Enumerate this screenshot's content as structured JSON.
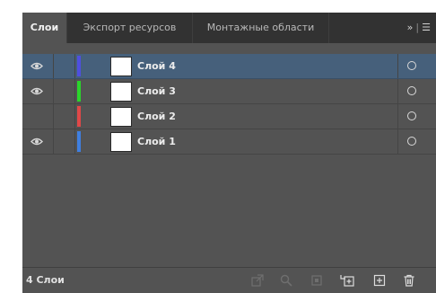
{
  "tabs": [
    {
      "label": "Слои",
      "active": true
    },
    {
      "label": "Экспорт ресурсов",
      "active": false
    },
    {
      "label": "Монтажные области",
      "active": false
    }
  ],
  "tab_menu": {
    "overflow": "»",
    "separator": "|",
    "menu": "☰"
  },
  "layers": [
    {
      "name": "Слой 4",
      "visible": true,
      "color": "#4f4fe0",
      "selected": true
    },
    {
      "name": "Слой 3",
      "visible": true,
      "color": "#2bd52b",
      "selected": false
    },
    {
      "name": "Слой 2",
      "visible": false,
      "color": "#e04848",
      "selected": false
    },
    {
      "name": "Слой 1",
      "visible": true,
      "color": "#3f7fe0",
      "selected": false
    }
  ],
  "footer": {
    "count_label": "4 Слои",
    "icons": [
      "export-icon",
      "search-icon",
      "clipping-mask-icon",
      "new-sublayer-icon",
      "new-layer-icon",
      "trash-icon"
    ]
  }
}
